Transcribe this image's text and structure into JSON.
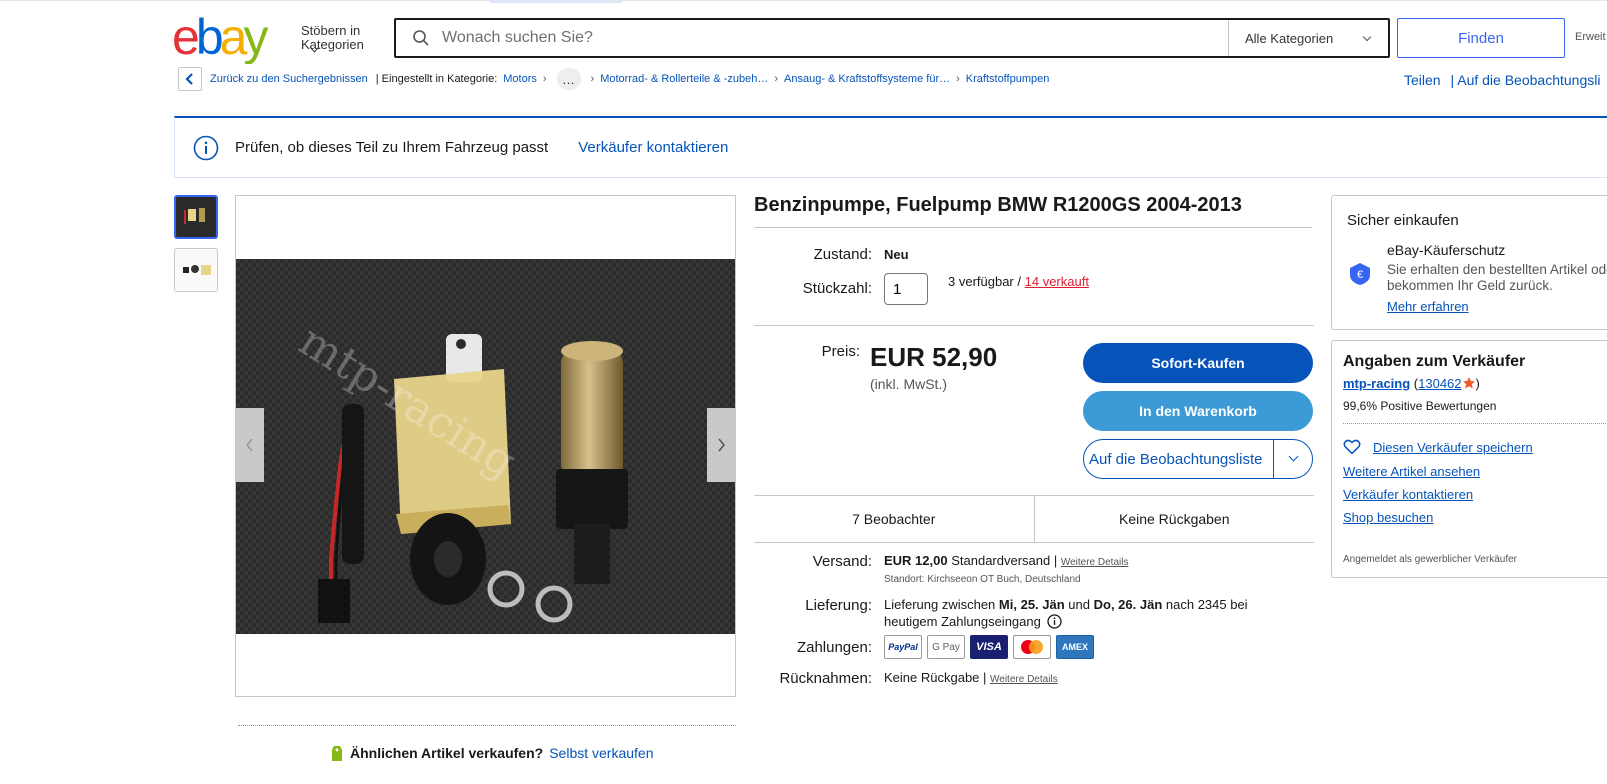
{
  "header": {
    "logo_text": "ebay",
    "browse_label": "Stöbern in Kategorien",
    "search_placeholder": "Wonach suchen Sie?",
    "category_select": "Alle Kategorien",
    "find_button": "Finden",
    "advanced_label": "Erweit"
  },
  "breadcrumb": {
    "back_label": "Zurück zu den Suchergebnissen",
    "listed_in": "| Eingestellt in Kategorie:",
    "items": [
      "Motors",
      "Motorrad- & Rollerteile & -zubeh…",
      "Ansaug- & Kraftstoffsysteme für…",
      "Kraftstoffpumpen"
    ],
    "more_label": "…",
    "share_label": "Teilen",
    "watchlist_label": "| Auf die Beobachtungsli"
  },
  "infobar": {
    "text": "Prüfen, ob dieses Teil zu Ihrem Fahrzeug passt",
    "contact_link": "Verkäufer kontaktieren"
  },
  "gallery": {
    "watermark": "mtp-racing",
    "sell_similar": "Ähnlichen Artikel verkaufen?",
    "sell_link": "Selbst verkaufen"
  },
  "item": {
    "title": "Benzinpumpe, Fuelpump BMW R1200GS 2004-2013",
    "condition_label": "Zustand:",
    "condition_value": "Neu",
    "quantity_label": "Stückzahl:",
    "quantity_value": "1",
    "available": "3 verfügbar /",
    "sold": "14 verkauft",
    "price_label": "Preis:",
    "price": "EUR 52,90",
    "vat": "(inkl. MwSt.)",
    "buy_now": "Sofort-Kaufen",
    "add_to_cart": "In den Warenkorb",
    "add_to_watchlist": "Auf die Beobachtungsliste",
    "watchers": "7 Beobachter",
    "returns_stat": "Keine Rückgaben",
    "shipping_label": "Versand:",
    "shipping_cost": "EUR 12,00",
    "shipping_type": "Standardversand |",
    "shipping_details": "Weitere Details",
    "location": "Standort: Kirchseeon OT Buch, Deutschland",
    "delivery_label": "Lieferung:",
    "delivery_pre": "Lieferung zwischen",
    "delivery_from": "Mi, 25. Jän",
    "delivery_and": "und",
    "delivery_to": "Do, 26. Jän",
    "delivery_post": "nach 2345 bei heutigem Zahlungseingang",
    "payments_label": "Zahlungen:",
    "payment_methods": [
      "PayPal",
      "G Pay",
      "VISA",
      "Mastercard",
      "AMEX"
    ],
    "returns_label": "Rücknahmen:",
    "returns_value": "Keine Rückgabe |",
    "returns_details": "Weitere Details"
  },
  "secure": {
    "heading": "Sicher einkaufen",
    "protection_title": "eBay-Käuferschutz",
    "protection_text": "Sie erhalten den bestellten Artikel oder bekommen Ihr Geld zurück.",
    "learn_more": "Mehr erfahren"
  },
  "seller": {
    "heading": "Angaben zum Verkäufer",
    "name": "mtp-racing",
    "feedback_count": "130462",
    "positive": "99,6% Positive Bewertungen",
    "save_seller": "Diesen Verkäufer speichern",
    "more_items": "Weitere Artikel ansehen",
    "contact": "Verkäufer kontaktieren",
    "visit_shop": "Shop besuchen",
    "business": "Angemeldet als gewerblicher Verkäufer"
  },
  "colors": {
    "ebay_red": "#e53238",
    "ebay_blue": "#0064d2",
    "ebay_yellow": "#f5af02",
    "ebay_green": "#86b817",
    "link": "#0654ba",
    "buy_button": "#0654ba",
    "cart_button": "#3c9bd6",
    "sold_red": "#dd1e31"
  }
}
